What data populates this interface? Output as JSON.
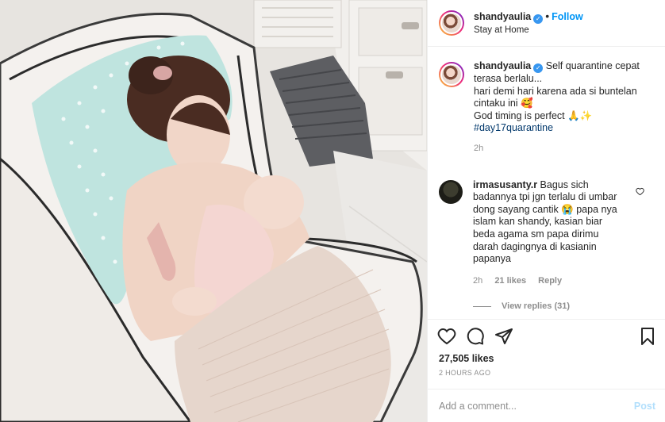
{
  "post": {
    "photo_alt": "photo",
    "author": {
      "username": "shandyaulia",
      "verified": true,
      "follow_label": "Follow",
      "location": "Stay at Home"
    },
    "caption": {
      "username": "shandyaulia",
      "lines": [
        "Self quarantine cepat",
        "terasa berlalu...",
        "hari demi hari karena ada si buntelan",
        "cintaku ini 🥰",
        "God timing is perfect 🙏✨"
      ],
      "hashtag": "#day17quarantine",
      "age": "2h"
    },
    "comments": [
      {
        "username": "irmasusanty.r",
        "text_lines": [
          "Bagus sich",
          "badannya tpi jgn terlalu di umbar",
          "dong sayang cantik 😭 papa nya",
          "islam kan shandy, kasian biar",
          "beda agama sm papa dirimu",
          "darah dagingnya di kasianin",
          "papanya"
        ],
        "age": "2h",
        "likes": "21 likes",
        "reply_label": "Reply",
        "view_replies": "View replies (31)"
      }
    ],
    "likes": "27,505 likes",
    "posted": "2 HOURS AGO",
    "add_comment": {
      "placeholder": "Add a comment...",
      "post_label": "Post"
    }
  },
  "icons": {
    "like": "heart-icon",
    "comment": "comment-icon",
    "share": "paper-plane-icon",
    "save": "bookmark-icon",
    "verified": "verified-badge-icon"
  },
  "colors": {
    "link_blue": "#0095f6",
    "hashtag": "#00376b",
    "muted": "#8e8e8e",
    "post_disabled": "#b2dffc"
  }
}
